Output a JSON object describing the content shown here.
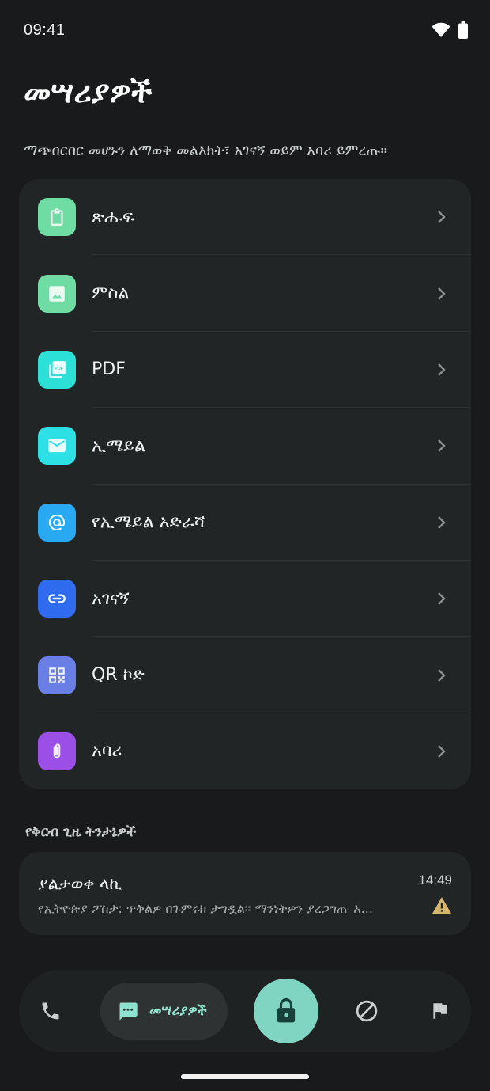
{
  "status_bar": {
    "time": "09:41"
  },
  "page": {
    "title": "መሣሪያዎች",
    "subtitle": "ማጭበርበር መሆኑን ለማወቅ መልእክት፣ አገናኝ ወይም አባሪ ይምረጡ።"
  },
  "types": [
    {
      "label": "ጽሑፍ",
      "icon": "clipboard-icon",
      "color": "#6fdca3"
    },
    {
      "label": "ምስል",
      "icon": "image-icon",
      "color": "#6fdca3"
    },
    {
      "label": "PDF",
      "icon": "pdf-icon",
      "color": "#2ce0d8"
    },
    {
      "label": "ኢሜይል",
      "icon": "mail-icon",
      "color": "#2ce0e6"
    },
    {
      "label": "የኢሜይል አድራሻ",
      "icon": "at-sign-icon",
      "color": "#29a9f2"
    },
    {
      "label": "አገናኝ",
      "icon": "link-icon",
      "color": "#2f6bef"
    },
    {
      "label": "QR ኮድ",
      "icon": "qr-code-icon",
      "color": "#6a7fe6"
    },
    {
      "label": "አባሪ",
      "icon": "paperclip-icon",
      "color": "#9b4fe6"
    }
  ],
  "recent": {
    "heading": "የቅርብ ጊዜ ትንታኔዎች",
    "items": [
      {
        "sender": "ያልታወቀ ላኪ",
        "time": "14:49",
        "preview": "የኢትዮጵያ ፖስታ: ጥቅልዎ በጉምሩክ ታግዷል። ማንነትዎን ያረጋግጡ እ...",
        "warning_color": "#d8b56c"
      }
    ]
  },
  "bottom_nav": {
    "active_label": "መሣሪያዎች",
    "accent": "#7fd5c2",
    "items": [
      "phone-icon",
      "message-icon",
      "lock-icon",
      "block-icon",
      "flag-icon"
    ]
  }
}
